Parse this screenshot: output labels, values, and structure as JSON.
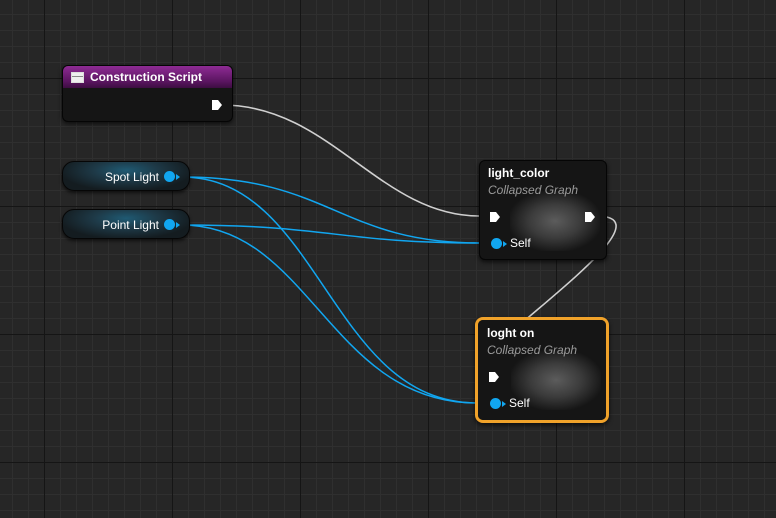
{
  "editor": {
    "colors": {
      "canvas_background": "#262626",
      "grid_major": "#151515",
      "grid_minor": "#2f2f2f",
      "exec_wire": "#d8d8d8",
      "object_wire": "#11a6f0",
      "selection_outline": "#f0a22a",
      "construction_header": "#8e2b94"
    }
  },
  "nodes": {
    "construction_script": {
      "title": "Construction Script",
      "icon": "function-entry-icon",
      "pins": [
        "exec-out"
      ]
    },
    "spot_light": {
      "label": "Spot Light",
      "pin_type": "object-reference"
    },
    "point_light": {
      "label": "Point Light",
      "pin_type": "object-reference"
    },
    "light_color": {
      "title": "light_color",
      "subtitle": "Collapsed Graph",
      "self_label": "Self",
      "selected": false
    },
    "loght_on": {
      "title": "loght on",
      "subtitle": "Collapsed Graph",
      "self_label": "Self",
      "selected": true
    }
  },
  "connections": [
    {
      "from": "construction_script.exec-out",
      "to": "light_color.exec-in",
      "kind": "exec"
    },
    {
      "from": "light_color.exec-out",
      "to": "loght_on.exec-in",
      "kind": "exec"
    },
    {
      "from": "spot_light.out",
      "to": "light_color.self",
      "kind": "object"
    },
    {
      "from": "spot_light.out",
      "to": "loght_on.self",
      "kind": "object"
    },
    {
      "from": "point_light.out",
      "to": "light_color.self",
      "kind": "object"
    },
    {
      "from": "point_light.out",
      "to": "loght_on.self",
      "kind": "object"
    }
  ]
}
